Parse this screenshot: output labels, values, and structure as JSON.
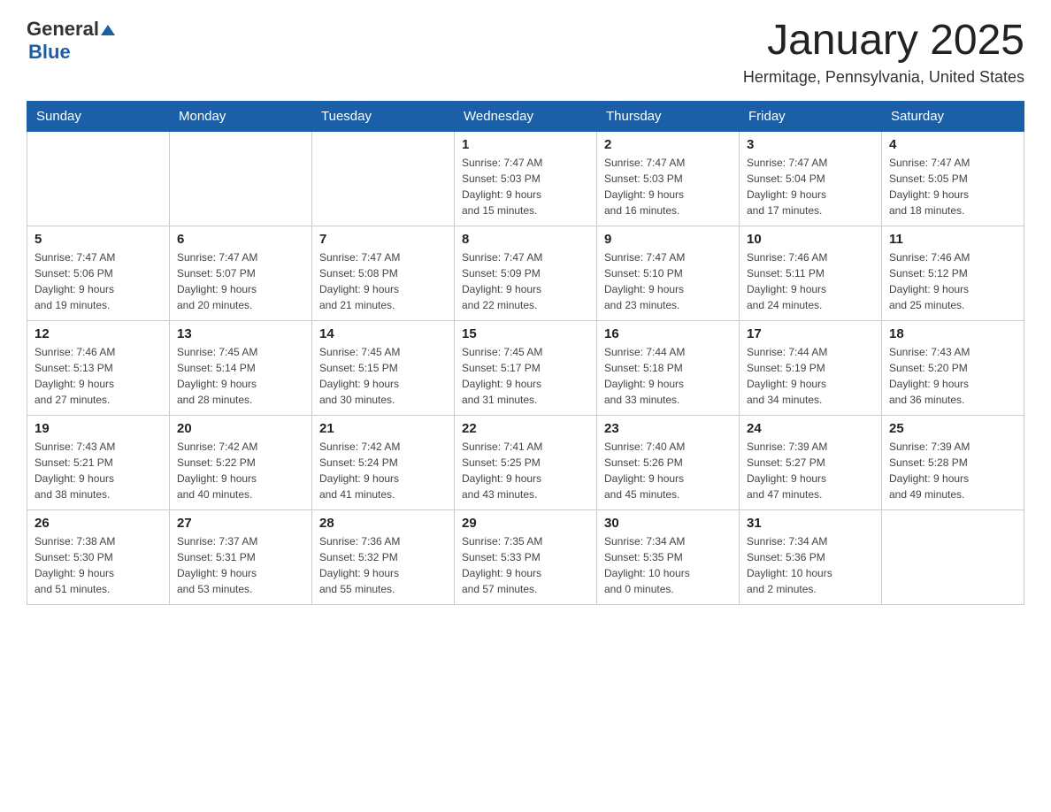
{
  "logo": {
    "text_general": "General",
    "text_blue": "Blue"
  },
  "title": {
    "month_year": "January 2025",
    "location": "Hermitage, Pennsylvania, United States"
  },
  "weekdays": [
    "Sunday",
    "Monday",
    "Tuesday",
    "Wednesday",
    "Thursday",
    "Friday",
    "Saturday"
  ],
  "weeks": [
    [
      {
        "day": "",
        "info": ""
      },
      {
        "day": "",
        "info": ""
      },
      {
        "day": "",
        "info": ""
      },
      {
        "day": "1",
        "info": "Sunrise: 7:47 AM\nSunset: 5:03 PM\nDaylight: 9 hours\nand 15 minutes."
      },
      {
        "day": "2",
        "info": "Sunrise: 7:47 AM\nSunset: 5:03 PM\nDaylight: 9 hours\nand 16 minutes."
      },
      {
        "day": "3",
        "info": "Sunrise: 7:47 AM\nSunset: 5:04 PM\nDaylight: 9 hours\nand 17 minutes."
      },
      {
        "day": "4",
        "info": "Sunrise: 7:47 AM\nSunset: 5:05 PM\nDaylight: 9 hours\nand 18 minutes."
      }
    ],
    [
      {
        "day": "5",
        "info": "Sunrise: 7:47 AM\nSunset: 5:06 PM\nDaylight: 9 hours\nand 19 minutes."
      },
      {
        "day": "6",
        "info": "Sunrise: 7:47 AM\nSunset: 5:07 PM\nDaylight: 9 hours\nand 20 minutes."
      },
      {
        "day": "7",
        "info": "Sunrise: 7:47 AM\nSunset: 5:08 PM\nDaylight: 9 hours\nand 21 minutes."
      },
      {
        "day": "8",
        "info": "Sunrise: 7:47 AM\nSunset: 5:09 PM\nDaylight: 9 hours\nand 22 minutes."
      },
      {
        "day": "9",
        "info": "Sunrise: 7:47 AM\nSunset: 5:10 PM\nDaylight: 9 hours\nand 23 minutes."
      },
      {
        "day": "10",
        "info": "Sunrise: 7:46 AM\nSunset: 5:11 PM\nDaylight: 9 hours\nand 24 minutes."
      },
      {
        "day": "11",
        "info": "Sunrise: 7:46 AM\nSunset: 5:12 PM\nDaylight: 9 hours\nand 25 minutes."
      }
    ],
    [
      {
        "day": "12",
        "info": "Sunrise: 7:46 AM\nSunset: 5:13 PM\nDaylight: 9 hours\nand 27 minutes."
      },
      {
        "day": "13",
        "info": "Sunrise: 7:45 AM\nSunset: 5:14 PM\nDaylight: 9 hours\nand 28 minutes."
      },
      {
        "day": "14",
        "info": "Sunrise: 7:45 AM\nSunset: 5:15 PM\nDaylight: 9 hours\nand 30 minutes."
      },
      {
        "day": "15",
        "info": "Sunrise: 7:45 AM\nSunset: 5:17 PM\nDaylight: 9 hours\nand 31 minutes."
      },
      {
        "day": "16",
        "info": "Sunrise: 7:44 AM\nSunset: 5:18 PM\nDaylight: 9 hours\nand 33 minutes."
      },
      {
        "day": "17",
        "info": "Sunrise: 7:44 AM\nSunset: 5:19 PM\nDaylight: 9 hours\nand 34 minutes."
      },
      {
        "day": "18",
        "info": "Sunrise: 7:43 AM\nSunset: 5:20 PM\nDaylight: 9 hours\nand 36 minutes."
      }
    ],
    [
      {
        "day": "19",
        "info": "Sunrise: 7:43 AM\nSunset: 5:21 PM\nDaylight: 9 hours\nand 38 minutes."
      },
      {
        "day": "20",
        "info": "Sunrise: 7:42 AM\nSunset: 5:22 PM\nDaylight: 9 hours\nand 40 minutes."
      },
      {
        "day": "21",
        "info": "Sunrise: 7:42 AM\nSunset: 5:24 PM\nDaylight: 9 hours\nand 41 minutes."
      },
      {
        "day": "22",
        "info": "Sunrise: 7:41 AM\nSunset: 5:25 PM\nDaylight: 9 hours\nand 43 minutes."
      },
      {
        "day": "23",
        "info": "Sunrise: 7:40 AM\nSunset: 5:26 PM\nDaylight: 9 hours\nand 45 minutes."
      },
      {
        "day": "24",
        "info": "Sunrise: 7:39 AM\nSunset: 5:27 PM\nDaylight: 9 hours\nand 47 minutes."
      },
      {
        "day": "25",
        "info": "Sunrise: 7:39 AM\nSunset: 5:28 PM\nDaylight: 9 hours\nand 49 minutes."
      }
    ],
    [
      {
        "day": "26",
        "info": "Sunrise: 7:38 AM\nSunset: 5:30 PM\nDaylight: 9 hours\nand 51 minutes."
      },
      {
        "day": "27",
        "info": "Sunrise: 7:37 AM\nSunset: 5:31 PM\nDaylight: 9 hours\nand 53 minutes."
      },
      {
        "day": "28",
        "info": "Sunrise: 7:36 AM\nSunset: 5:32 PM\nDaylight: 9 hours\nand 55 minutes."
      },
      {
        "day": "29",
        "info": "Sunrise: 7:35 AM\nSunset: 5:33 PM\nDaylight: 9 hours\nand 57 minutes."
      },
      {
        "day": "30",
        "info": "Sunrise: 7:34 AM\nSunset: 5:35 PM\nDaylight: 10 hours\nand 0 minutes."
      },
      {
        "day": "31",
        "info": "Sunrise: 7:34 AM\nSunset: 5:36 PM\nDaylight: 10 hours\nand 2 minutes."
      },
      {
        "day": "",
        "info": ""
      }
    ]
  ]
}
